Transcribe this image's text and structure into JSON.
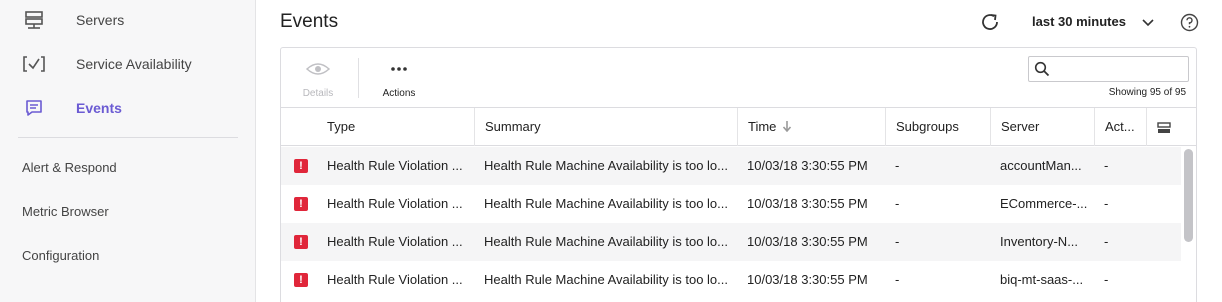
{
  "sidebar": {
    "items": [
      {
        "label": "Servers",
        "icon": "servers-icon"
      },
      {
        "label": "Service Availability",
        "icon": "service-check-icon"
      },
      {
        "label": "Events",
        "icon": "events-icon",
        "active": true
      }
    ],
    "sub_items": [
      {
        "label": "Alert & Respond"
      },
      {
        "label": "Metric Browser"
      },
      {
        "label": "Configuration"
      }
    ],
    "accent_color": "#6b5bd3"
  },
  "header": {
    "title": "Events",
    "time_range": "last 30 minutes"
  },
  "toolbar": {
    "details_label": "Details",
    "actions_label": "Actions",
    "search": {
      "value": "",
      "placeholder": ""
    },
    "showing": "Showing 95 of 95"
  },
  "table": {
    "columns": [
      "Type",
      "Summary",
      "Time",
      "Subgroups",
      "Server",
      "Act..."
    ],
    "sorted_column": "Time",
    "sort_direction": "descending",
    "rows": [
      {
        "type": "Health Rule Violation ...",
        "summary": "Health Rule Machine Availability is too lo...",
        "time": "10/03/18 3:30:55 PM",
        "subgroups": "-",
        "server": "accountMan...",
        "actions": "-"
      },
      {
        "type": "Health Rule Violation ...",
        "summary": "Health Rule Machine Availability is too lo...",
        "time": "10/03/18 3:30:55 PM",
        "subgroups": "-",
        "server": "ECommerce-...",
        "actions": "-"
      },
      {
        "type": "Health Rule Violation ...",
        "summary": "Health Rule Machine Availability is too lo...",
        "time": "10/03/18 3:30:55 PM",
        "subgroups": "-",
        "server": "Inventory-N...",
        "actions": "-"
      },
      {
        "type": "Health Rule Violation ...",
        "summary": "Health Rule Machine Availability is too lo...",
        "time": "10/03/18 3:30:55 PM",
        "subgroups": "-",
        "server": "biq-mt-saas-...",
        "actions": "-"
      }
    ],
    "severity_color": "#e0263a"
  }
}
